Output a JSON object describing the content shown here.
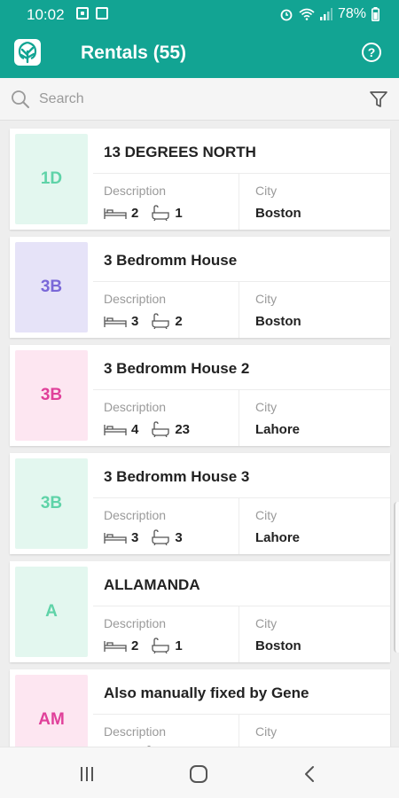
{
  "status_bar": {
    "time": "10:02",
    "battery": "78%",
    "icons": [
      "image-icon",
      "screen-icon",
      "alarm-icon",
      "wifi-icon",
      "signal-icon",
      "battery-icon"
    ]
  },
  "app_bar": {
    "title": "Rentals (55)",
    "logo_icon": "tree-logo-icon",
    "help_icon": "help-icon"
  },
  "search": {
    "placeholder": "Search",
    "value": "",
    "filter_icon": "filter-icon"
  },
  "labels": {
    "description": "Description",
    "city": "City"
  },
  "rentals": [
    {
      "badge": "1D",
      "name": "13 DEGREES NORTH",
      "bedrooms": "2",
      "bathrooms": "1",
      "city": "Boston",
      "badge_bg": "#e3f7ef",
      "badge_fg": "#5fd3a8"
    },
    {
      "badge": "3B",
      "name": "3 Bedromm House",
      "bedrooms": "3",
      "bathrooms": "2",
      "city": "Boston",
      "badge_bg": "#e6e3f8",
      "badge_fg": "#7a68d8"
    },
    {
      "badge": "3B",
      "name": "3 Bedromm House 2",
      "bedrooms": "4",
      "bathrooms": "23",
      "city": "Lahore",
      "badge_bg": "#fde6f1",
      "badge_fg": "#e0409a"
    },
    {
      "badge": "3B",
      "name": "3 Bedromm House 3",
      "bedrooms": "3",
      "bathrooms": "3",
      "city": "Lahore",
      "badge_bg": "#e3f7ef",
      "badge_fg": "#5fd3a8"
    },
    {
      "badge": "A",
      "name": "ALLAMANDA",
      "bedrooms": "2",
      "bathrooms": "1",
      "city": "Boston",
      "badge_bg": "#e3f7ef",
      "badge_fg": "#5fd3a8"
    },
    {
      "badge": "AM",
      "name": "Also manually fixed by Gene",
      "bedrooms": "",
      "bathrooms": "",
      "city": "",
      "badge_bg": "#fde6f1",
      "badge_fg": "#e0409a"
    }
  ],
  "colors": {
    "primary": "#12a493",
    "background": "#eeeeee"
  },
  "nav_bar": {
    "icons": [
      "recent-apps-icon",
      "home-icon",
      "back-icon"
    ]
  }
}
